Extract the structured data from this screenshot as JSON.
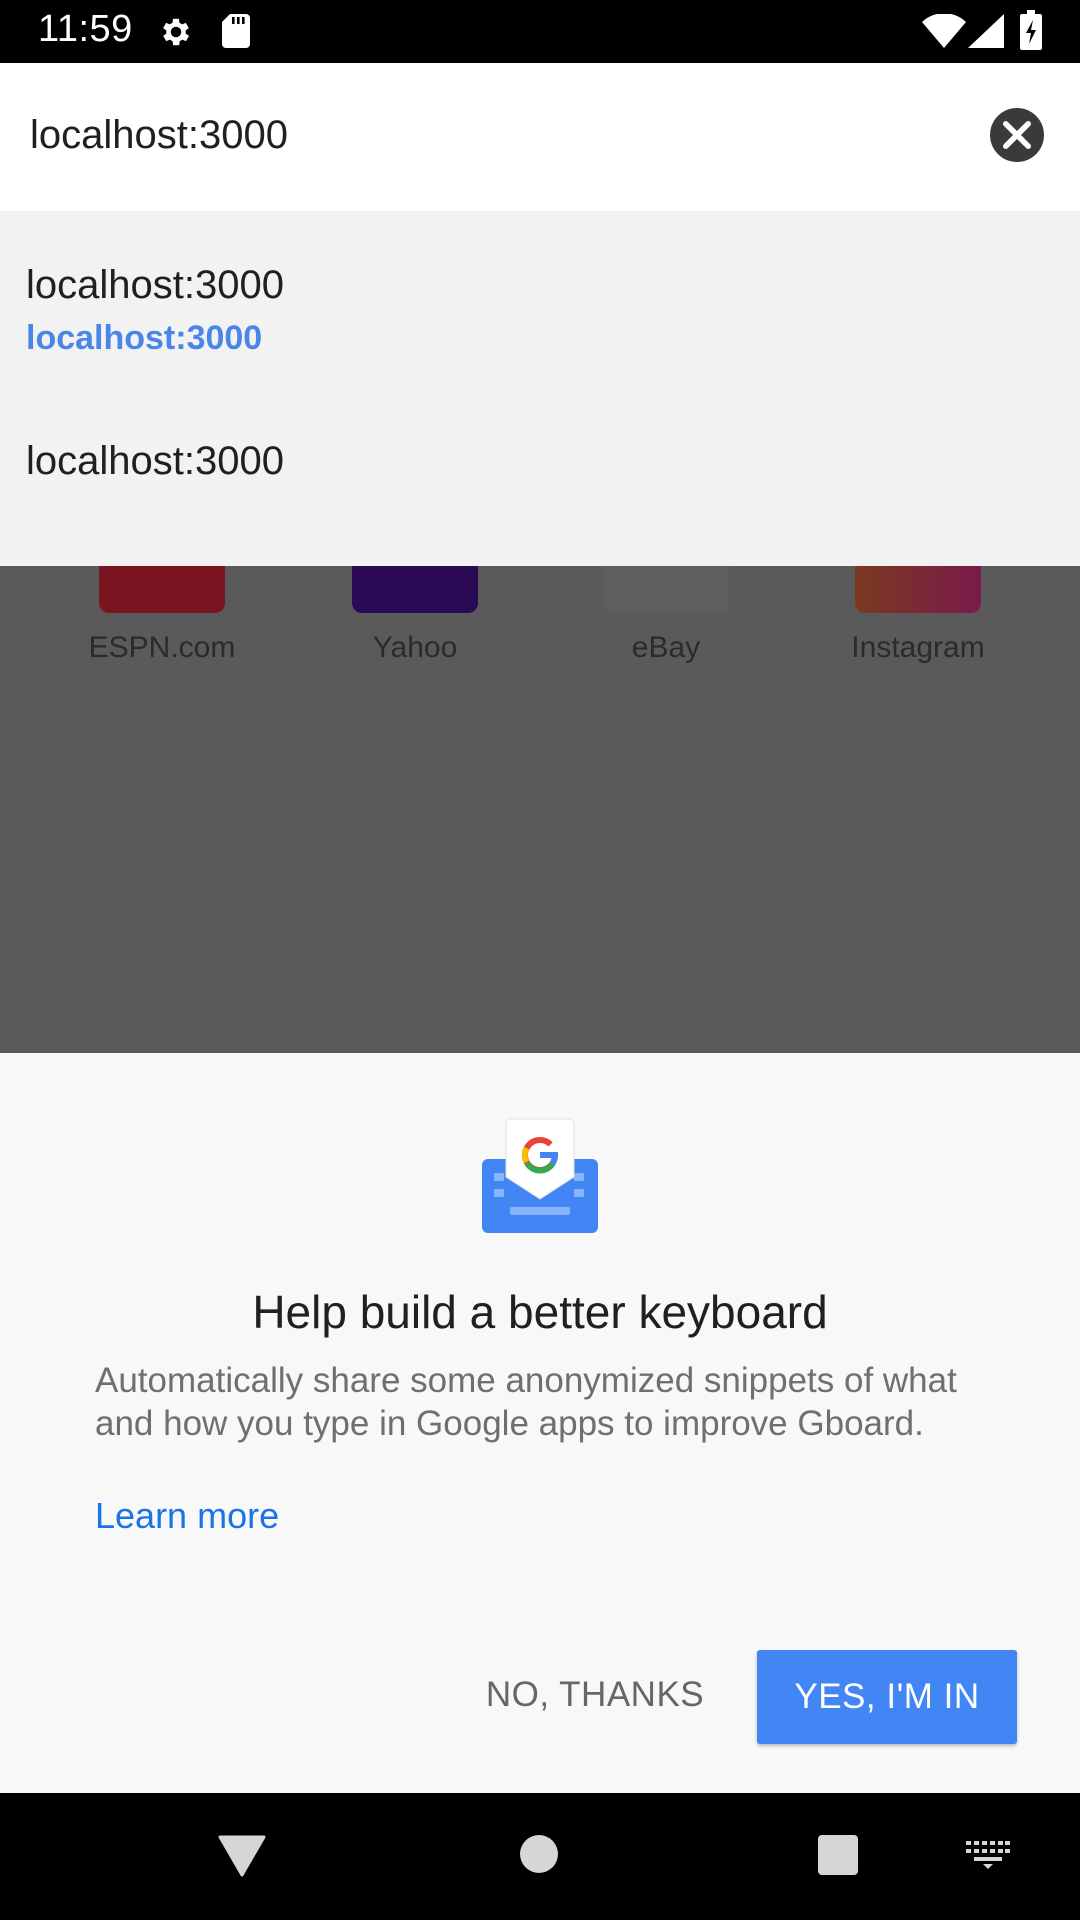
{
  "status_bar": {
    "time": "11:59",
    "icons": [
      "gear-icon",
      "sd-card-icon",
      "wifi-icon",
      "cell-signal-icon",
      "battery-charging-icon"
    ]
  },
  "omnibox": {
    "value": "localhost:3000",
    "clear_icon": "close-icon"
  },
  "suggestions": [
    {
      "title": "localhost:3000",
      "url": "localhost:3000"
    },
    {
      "title": "localhost:3000"
    }
  ],
  "background_tiles": [
    {
      "label": "ESPN.com",
      "color": "#c8102e"
    },
    {
      "label": "Yahoo",
      "color": "#400090"
    },
    {
      "label": "eBay",
      "color": "#f5f5f5"
    },
    {
      "label": "Instagram",
      "color": "#d6249f"
    }
  ],
  "gboard_dialog": {
    "logo_icon": "gboard-icon",
    "title": "Help build a better keyboard",
    "body": "Automatically share some anonymized snippets of what and how you type in Google apps to improve Gboard.",
    "learn_more": "Learn more",
    "no_thanks": "NO, THANKS",
    "yes": "YES, I'M IN",
    "accent_color": "#4285f4"
  },
  "nav_bar": {
    "icons": [
      "back-icon",
      "home-icon",
      "recents-icon",
      "keyboard-switch-icon"
    ]
  }
}
